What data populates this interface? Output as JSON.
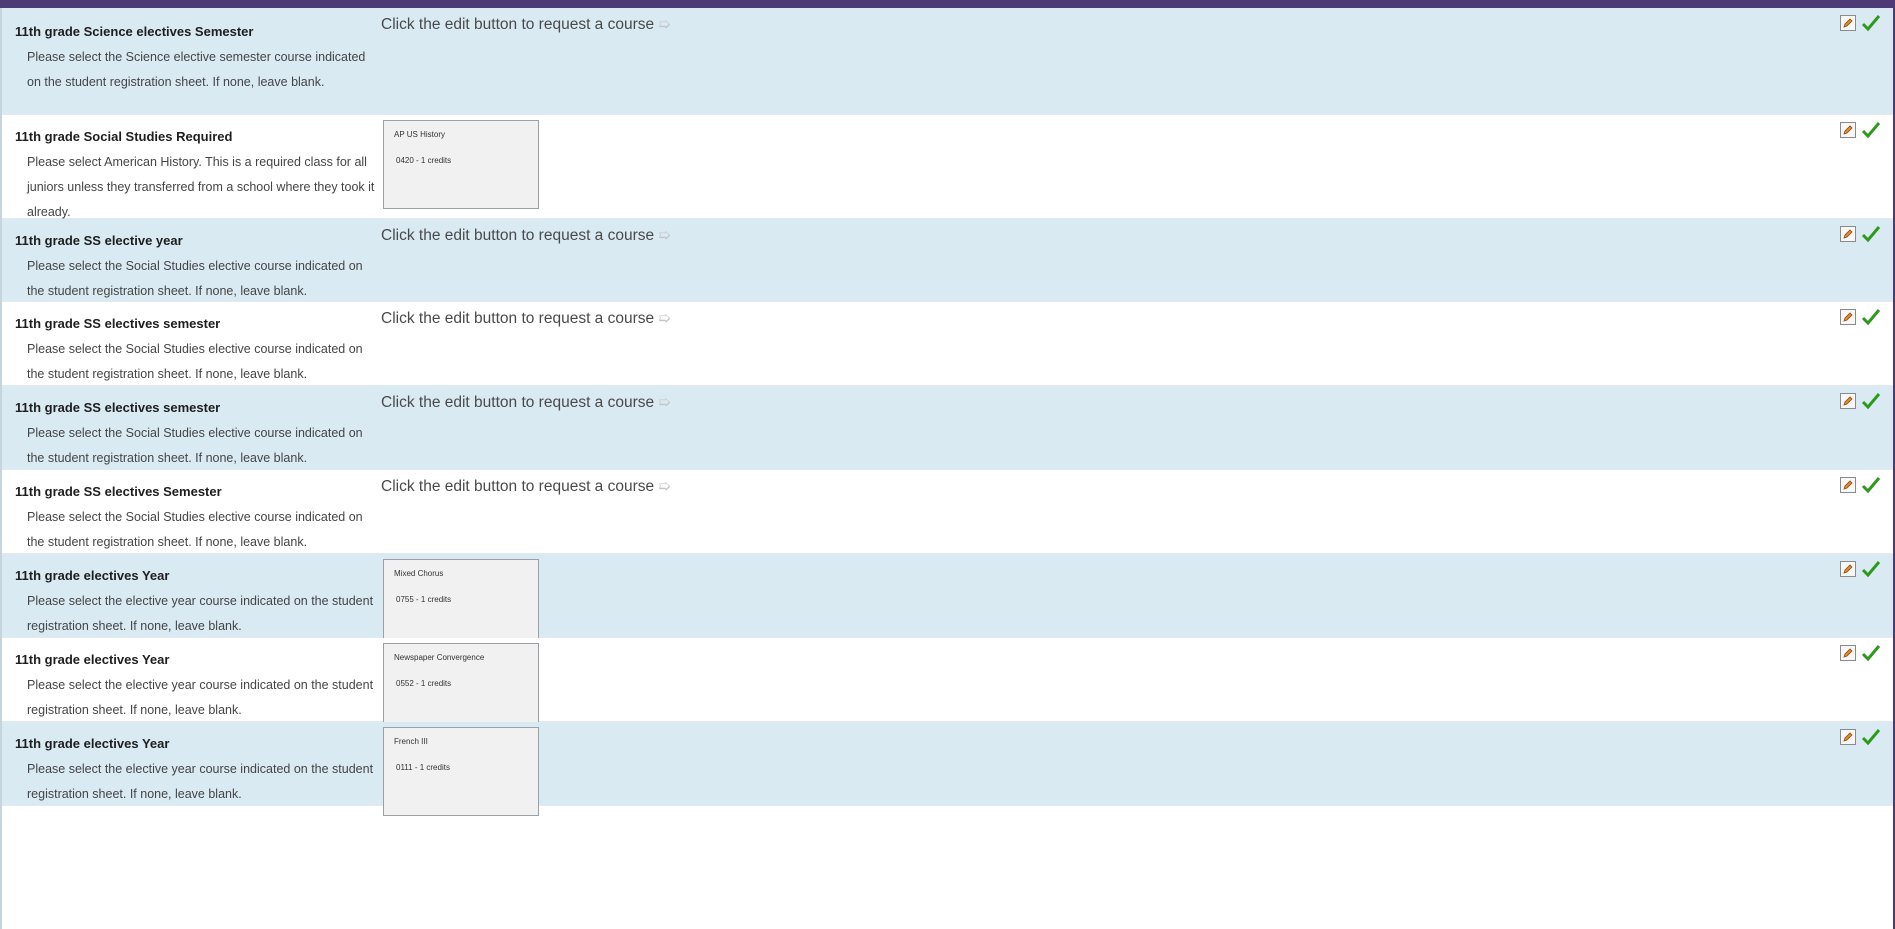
{
  "prompt_text": "Click the edit button to request a course",
  "rows": [
    {
      "title": "11th grade Science electives Semester",
      "desc": "Please select the Science elective semester course indicated on the student registration sheet. If none, leave blank.",
      "course": null,
      "course_code": null
    },
    {
      "title": "11th grade Social Studies Required",
      "desc": "Please select American History. This is a required class for all juniors unless they transferred from a school where they took it already.",
      "course": "AP US History",
      "course_code": "0420 - 1 credits"
    },
    {
      "title": "11th grade SS elective year",
      "desc": "Please select the Social Studies elective course indicated on the student registration sheet. If none, leave blank.",
      "course": null,
      "course_code": null
    },
    {
      "title": "11th grade SS electives semester",
      "desc": "Please select the Social Studies elective course indicated on the student registration sheet. If none, leave blank.",
      "course": null,
      "course_code": null
    },
    {
      "title": "11th grade SS electives semester",
      "desc": "Please select the Social Studies elective course indicated on the student registration sheet. If none, leave blank.",
      "course": null,
      "course_code": null
    },
    {
      "title": "11th grade SS electives Semester",
      "desc": "Please select the Social Studies elective course indicated on the student registration sheet. If none, leave blank.",
      "course": null,
      "course_code": null
    },
    {
      "title": "11th grade electives Year",
      "desc": "Please select the elective year course indicated on the student registration sheet. If none, leave blank.",
      "course": "Mixed Chorus",
      "course_code": "0755 - 1 credits"
    },
    {
      "title": "11th grade electives Year",
      "desc": "Please select the elective year course indicated on the student registration sheet. If none, leave blank.",
      "course": "Newspaper Convergence",
      "course_code": "0552 - 1 credits"
    },
    {
      "title": "11th grade electives Year",
      "desc": "Please select the elective year course indicated on the student registration sheet. If none, leave blank.",
      "course": "French III",
      "course_code": "0111 - 1 credits"
    }
  ],
  "colors": {
    "shaded_row": "#d9eaf3",
    "check": "#2e9a1c",
    "header_bar": "#4d3a77"
  }
}
